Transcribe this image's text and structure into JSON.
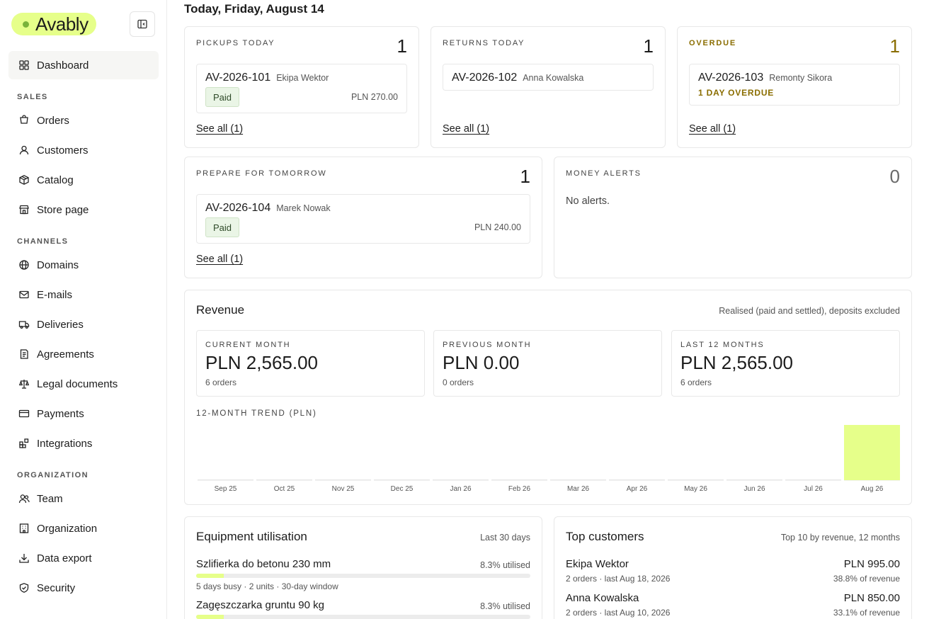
{
  "app": {
    "brand": "Avably",
    "accent_color": "#e6ff8a",
    "accent_dot_color": "#7ab33a",
    "warning_color": "#8a6d00",
    "paid_badge_bg": "#eaf5e6"
  },
  "sidebar": {
    "collapse_icon": "sidebar-collapse-icon",
    "dashboard": {
      "label": "Dashboard",
      "icon": "dashboard-icon"
    },
    "sections": [
      {
        "title": "SALES",
        "items": [
          {
            "label": "Orders",
            "icon": "orders-icon"
          },
          {
            "label": "Customers",
            "icon": "user-icon"
          },
          {
            "label": "Catalog",
            "icon": "box-icon"
          },
          {
            "label": "Store page",
            "icon": "store-icon"
          }
        ]
      },
      {
        "title": "CHANNELS",
        "items": [
          {
            "label": "Domains",
            "icon": "globe-icon"
          },
          {
            "label": "E-mails",
            "icon": "mail-icon"
          },
          {
            "label": "Deliveries",
            "icon": "truck-icon"
          },
          {
            "label": "Agreements",
            "icon": "agreement-icon"
          },
          {
            "label": "Legal documents",
            "icon": "scale-icon"
          },
          {
            "label": "Payments",
            "icon": "card-icon"
          },
          {
            "label": "Integrations",
            "icon": "blocks-icon"
          }
        ]
      },
      {
        "title": "ORGANIZATION",
        "items": [
          {
            "label": "Team",
            "icon": "team-icon"
          },
          {
            "label": "Organization",
            "icon": "building-icon"
          },
          {
            "label": "Data export",
            "icon": "download-icon"
          },
          {
            "label": "Security",
            "icon": "shield-icon"
          }
        ]
      }
    ]
  },
  "header": {
    "title": "Today, Friday, August 14"
  },
  "pickups": {
    "label": "PICKUPS TODAY",
    "count": "1",
    "order": {
      "id": "AV-2026-101",
      "customer": "Ekipa Wektor",
      "badge": "Paid",
      "amount": "PLN 270.00"
    },
    "see_all": "See all (1)"
  },
  "returns": {
    "label": "RETURNS TODAY",
    "count": "1",
    "order": {
      "id": "AV-2026-102",
      "customer": "Anna Kowalska"
    },
    "see_all": "See all (1)"
  },
  "overdue": {
    "label": "OVERDUE",
    "count": "1",
    "order": {
      "id": "AV-2026-103",
      "customer": "Remonty Sikora",
      "status": "1 DAY OVERDUE"
    },
    "see_all": "See all (1)"
  },
  "prepare": {
    "label": "PREPARE FOR TOMORROW",
    "count": "1",
    "order": {
      "id": "AV-2026-104",
      "customer": "Marek Nowak",
      "badge": "Paid",
      "amount": "PLN 240.00"
    },
    "see_all": "See all (1)"
  },
  "money_alerts": {
    "label": "MONEY ALERTS",
    "count": "0",
    "empty_text": "No alerts."
  },
  "revenue": {
    "title": "Revenue",
    "note": "Realised (paid and settled), deposits excluded",
    "stats": [
      {
        "label": "CURRENT MONTH",
        "value": "PLN 2,565.00",
        "sub": "6 orders"
      },
      {
        "label": "PREVIOUS MONTH",
        "value": "PLN 0.00",
        "sub": "0 orders"
      },
      {
        "label": "LAST 12 MONTHS",
        "value": "PLN 2,565.00",
        "sub": "6 orders"
      }
    ],
    "trend_label": "12-MONTH TREND (PLN)"
  },
  "chart_data": {
    "type": "bar",
    "title": "12-MONTH TREND (PLN)",
    "categories": [
      "Sep 25",
      "Oct 25",
      "Nov 25",
      "Dec 25",
      "Jan 26",
      "Feb 26",
      "Mar 26",
      "Apr 26",
      "May 26",
      "Jun 26",
      "Jul 26",
      "Aug 26"
    ],
    "values": [
      0,
      0,
      0,
      0,
      0,
      0,
      0,
      0,
      0,
      0,
      0,
      2565
    ],
    "ylim": [
      0,
      2565
    ],
    "grid": false,
    "bar_color": "#e6ff8a"
  },
  "equipment": {
    "title": "Equipment utilisation",
    "note": "Last 30 days",
    "items": [
      {
        "name": "Szlifierka do betonu 230 mm",
        "pct_label": "8.3% utilised",
        "utilisation": 0.083,
        "meta": "5 days busy · 2 units · 30-day window"
      },
      {
        "name": "Zagęszczarka gruntu 90 kg",
        "pct_label": "8.3% utilised",
        "utilisation": 0.083
      }
    ]
  },
  "top_customers": {
    "title": "Top customers",
    "note": "Top 10 by revenue, 12 months",
    "items": [
      {
        "name": "Ekipa Wektor",
        "meta": "2 orders · last Aug 18, 2026",
        "amount": "PLN 995.00",
        "share": "38.8% of revenue"
      },
      {
        "name": "Anna Kowalska",
        "meta": "2 orders · last Aug 10, 2026",
        "amount": "PLN 850.00",
        "share": "33.1% of revenue"
      }
    ]
  }
}
